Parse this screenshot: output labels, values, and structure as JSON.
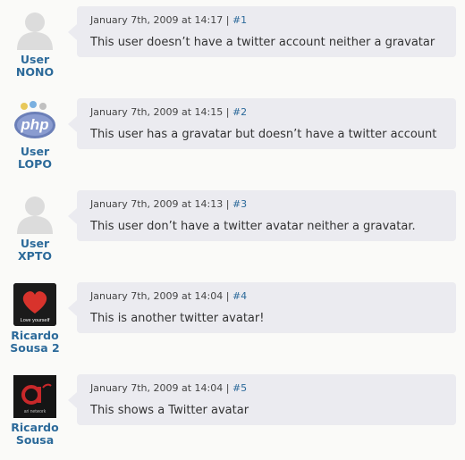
{
  "comments": [
    {
      "author_line1": "User",
      "author_line2": "NONO",
      "avatar": "default-avatar",
      "date": "January 7th, 2009 at 14:17",
      "separator": "|",
      "permalink": "#1",
      "text": "This user doesn’t have a twitter account neither a gravatar"
    },
    {
      "author_line1": "User",
      "author_line2": "LOPO",
      "avatar": "php-logo-avatar",
      "avatar_text": "php",
      "date": "January 7th, 2009 at 14:15",
      "separator": "|",
      "permalink": "#2",
      "text": "This user has a gravatar but doesn’t have a twitter account"
    },
    {
      "author_line1": "User",
      "author_line2": "XPTO",
      "avatar": "default-avatar",
      "date": "January 7th, 2009 at 14:13",
      "separator": "|",
      "permalink": "#3",
      "text": "This user don’t have a twitter avatar neither a gravatar."
    },
    {
      "author_line1": "Ricardo",
      "author_line2": "Sousa 2",
      "avatar": "heart-avatar",
      "avatar_text": "Love yourself",
      "date": "January 7th, 2009 at 14:04",
      "separator": "|",
      "permalink": "#4",
      "text": "This is another twitter avatar!"
    },
    {
      "author_line1": "Ricardo",
      "author_line2": "Sousa",
      "avatar": "ari-network-avatar",
      "avatar_text": "ari network",
      "date": "January 7th, 2009 at 14:04",
      "separator": "|",
      "permalink": "#5",
      "text": "This shows a Twitter avatar"
    }
  ],
  "colors": {
    "link": "#2c6a9a",
    "bubble": "#ebebf0",
    "background": "#fafaf8"
  }
}
